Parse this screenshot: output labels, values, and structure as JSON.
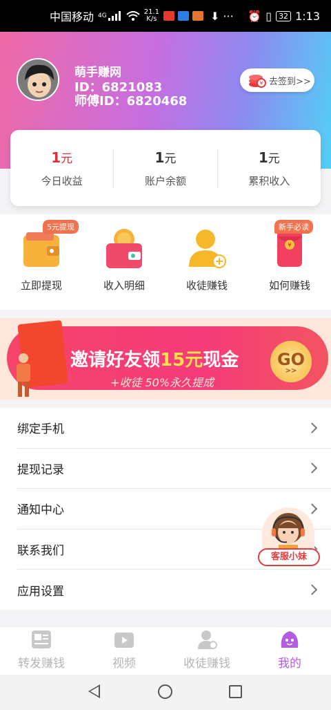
{
  "status_bar": {
    "carrier": "中国移动",
    "network": "4G",
    "speed_value": "21.1",
    "speed_unit": "K/s",
    "battery": "32",
    "time": "1:13",
    "icons": [
      "signal-icon",
      "wifi-icon",
      "wechat-icon",
      "download-icon",
      "more-icon",
      "alarm-icon",
      "vibrate-icon",
      "battery-icon"
    ]
  },
  "profile": {
    "name": "萌手赚网",
    "id_text": "ID：6821083",
    "master_id_text": "师傅ID：6820468",
    "signin_label": "去签到>>"
  },
  "stats": [
    {
      "value": "1",
      "unit": "元",
      "label": "今日收益"
    },
    {
      "value": "1",
      "unit": "元",
      "label": "账户余额"
    },
    {
      "value": "1",
      "unit": "元",
      "label": "累积收入"
    }
  ],
  "actions": [
    {
      "label": "立即提现",
      "badge": "5元提现",
      "icon": "wallet-icon"
    },
    {
      "label": "收入明细",
      "badge": "",
      "icon": "coin-wallet-icon"
    },
    {
      "label": "收徒赚钱",
      "badge": "",
      "icon": "add-user-icon"
    },
    {
      "label": "如何赚钱",
      "badge": "新手必读",
      "icon": "red-envelope-icon"
    }
  ],
  "banner": {
    "title_part1": "邀请好友领",
    "title_highlight": "15元",
    "title_part2": "现金",
    "subtitle": "+收徒 50%永久提成",
    "go_label": "GO",
    "go_arrows": ">>"
  },
  "menu": [
    {
      "label": "绑定手机"
    },
    {
      "label": "提现记录"
    },
    {
      "label": "通知中心"
    },
    {
      "label": "联系我们"
    },
    {
      "label": "应用设置"
    }
  ],
  "customer_service": {
    "label": "客服小妹"
  },
  "tabs": [
    {
      "label": "转发赚钱",
      "icon": "article-icon",
      "active": false
    },
    {
      "label": "视频",
      "icon": "video-icon",
      "active": false
    },
    {
      "label": "收徒赚钱",
      "icon": "user-add-icon",
      "active": false
    },
    {
      "label": "我的",
      "icon": "profile-face-icon",
      "active": true
    }
  ],
  "colors": {
    "accent_purple": "#b35ce0",
    "stat_red": "#e0313a",
    "badge_orange": "#f2724d",
    "header_gradient": [
      "#f06aa6",
      "#c66ee0",
      "#52d0f6"
    ]
  }
}
